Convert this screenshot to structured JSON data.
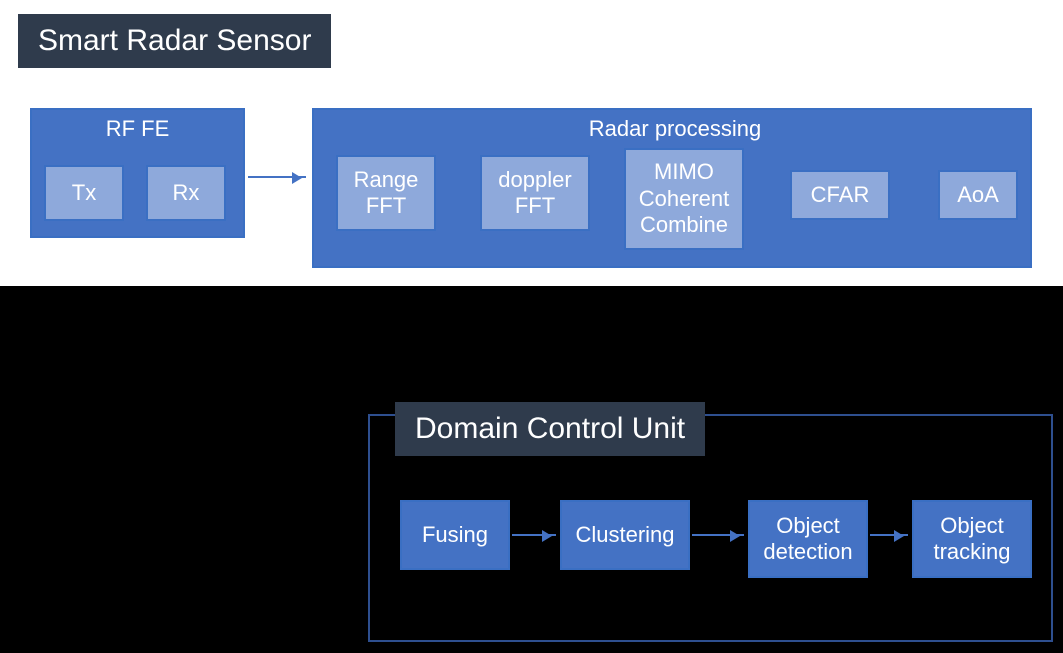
{
  "titles": {
    "top": "Smart Radar Sensor",
    "bottom": "Domain Control Unit"
  },
  "rf_fe": {
    "label": "RF FE",
    "tx": "Tx",
    "rx": "Rx"
  },
  "radar_processing": {
    "label": "Radar processing",
    "range_fft": "Range FFT",
    "doppler_fft": "doppler FFT",
    "mimo": "MIMO Coherent Combine",
    "cfar": "CFAR",
    "aoa": "AoA"
  },
  "dcu": {
    "fusing": "Fusing",
    "clustering": "Clustering",
    "object_detection": "Object detection",
    "object_tracking": "Object tracking"
  },
  "colors": {
    "dark_block": "#4472c4",
    "light_block": "#8ea9db",
    "title_bg": "#2f3b4c",
    "border": "#3a6fc3"
  }
}
